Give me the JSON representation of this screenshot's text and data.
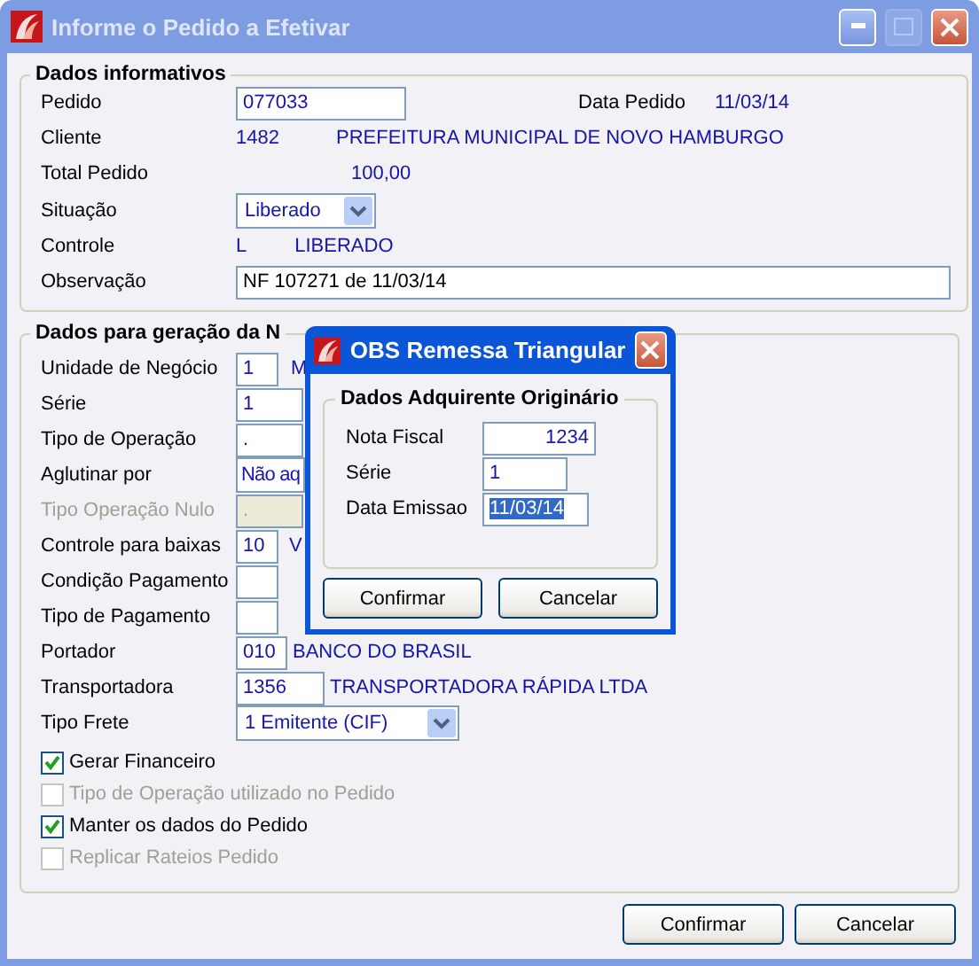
{
  "window": {
    "title": "Informe o Pedido a Efetivar",
    "active": false
  },
  "info": {
    "title": "Dados informativos",
    "pedido": {
      "label": "Pedido",
      "value": "077033"
    },
    "data_pedido": {
      "label": "Data Pedido",
      "value": "11/03/14"
    },
    "cliente": {
      "label": "Cliente",
      "code": "1482",
      "name": "PREFEITURA MUNICIPAL DE NOVO HAMBURGO"
    },
    "total": {
      "label": "Total Pedido",
      "value": "100,00"
    },
    "situacao": {
      "label": "Situação",
      "value": "Liberado"
    },
    "controle": {
      "label": "Controle",
      "code": "L",
      "name": "LIBERADO"
    },
    "observacao": {
      "label": "Observação",
      "value": "NF 107271 de 11/03/14"
    }
  },
  "nota": {
    "title": "Dados para geração da N",
    "fields": [
      {
        "kind": "code",
        "label": "Unidade de Negócio",
        "value": "1",
        "description": "M",
        "disabled": false
      },
      {
        "kind": "code",
        "label": "Série",
        "value": "1",
        "disabled": false
      },
      {
        "kind": "code",
        "label": "Tipo de Operação",
        "value": ".",
        "disabled": false
      },
      {
        "kind": "select",
        "label": "Aglutinar por",
        "value": "Não aq",
        "disabled": false
      },
      {
        "kind": "code",
        "label": "Tipo Operação Nulo",
        "value": ".",
        "disabled": true
      },
      {
        "kind": "code",
        "label": "Controle para baixas",
        "value": "10",
        "description": "V",
        "disabled": false
      },
      {
        "kind": "code",
        "label": "Condição Pagamento",
        "disabled": false
      },
      {
        "kind": "code",
        "label": "Tipo de Pagamento",
        "disabled": false
      },
      {
        "kind": "code",
        "label": "Portador",
        "value": "010",
        "description": "BANCO DO BRASIL",
        "disabled": false
      },
      {
        "kind": "code",
        "label": "Transportadora",
        "value": "1356",
        "description": "TRANSPORTADORA RÁPIDA LTDA",
        "disabled": false
      },
      {
        "kind": "select",
        "label": "Tipo Frete",
        "value": "1 Emitente (CIF)",
        "disabled": false
      }
    ],
    "checks": [
      {
        "label": "Gerar Financeiro",
        "checked": true,
        "disabled": false
      },
      {
        "label": "Tipo de Operação utilizado no Pedido",
        "checked": false,
        "disabled": true
      },
      {
        "label": "Manter os dados do Pedido",
        "checked": true,
        "disabled": false
      },
      {
        "label": "Replicar Rateios Pedido",
        "checked": false,
        "disabled": true
      }
    ]
  },
  "buttons": [
    "Confirmar",
    "Cancelar"
  ],
  "dialog": {
    "title": "OBS Remessa Triangular",
    "active": true,
    "group": "Dados Adquirente Originário",
    "fields": [
      {
        "kind": "number",
        "label": "Nota Fiscal",
        "value": "1234",
        "selected": false
      },
      {
        "kind": "text",
        "label": "Série",
        "value": "1",
        "selected": false
      },
      {
        "kind": "text",
        "label": "Data Emissao",
        "value": "11/03/14",
        "selected": true
      }
    ],
    "buttons": [
      "Confirmar",
      "Cancelar"
    ]
  }
}
